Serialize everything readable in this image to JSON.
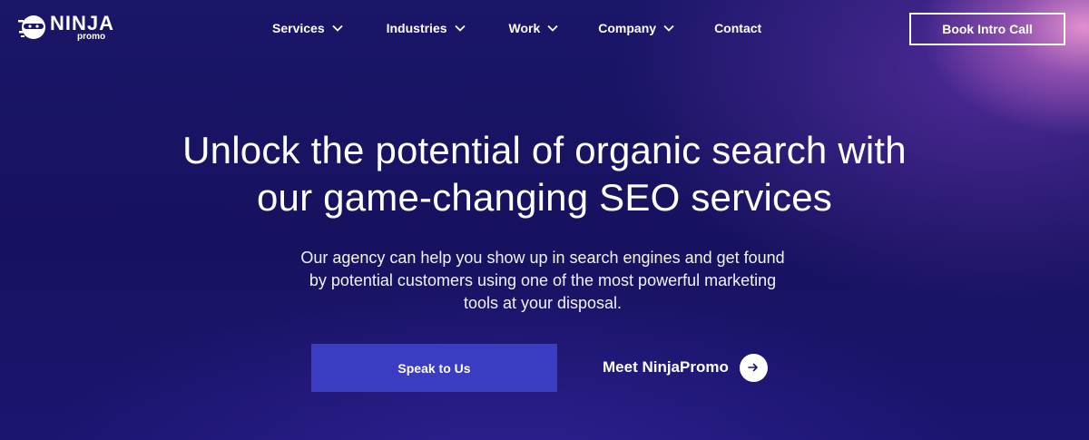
{
  "brand": {
    "logo_word": "NINJA",
    "logo_sub": "promo",
    "logo_icon": "ninja-head-icon"
  },
  "nav": {
    "items": [
      {
        "label": "Services",
        "has_dropdown": true
      },
      {
        "label": "Industries",
        "has_dropdown": true
      },
      {
        "label": "Work",
        "has_dropdown": true
      },
      {
        "label": "Company",
        "has_dropdown": true
      },
      {
        "label": "Contact",
        "has_dropdown": false
      }
    ],
    "cta_label": "Book Intro Call"
  },
  "hero": {
    "headline_line1": "Unlock the potential of organic search with",
    "headline_line2": "our game-changing SEO services",
    "subtext_line1": "Our agency can help you show up in search engines and get found",
    "subtext_line2": "by potential customers using one of the most powerful marketing",
    "subtext_line3": "tools at your disposal.",
    "primary_button": "Speak to Us",
    "secondary_link": "Meet NinjaPromo",
    "secondary_icon": "arrow-right-icon"
  },
  "colors": {
    "background": "#17125f",
    "primary_button": "#3a3cc4",
    "accent_glow": "#ec96d2",
    "text": "#ffffff"
  }
}
